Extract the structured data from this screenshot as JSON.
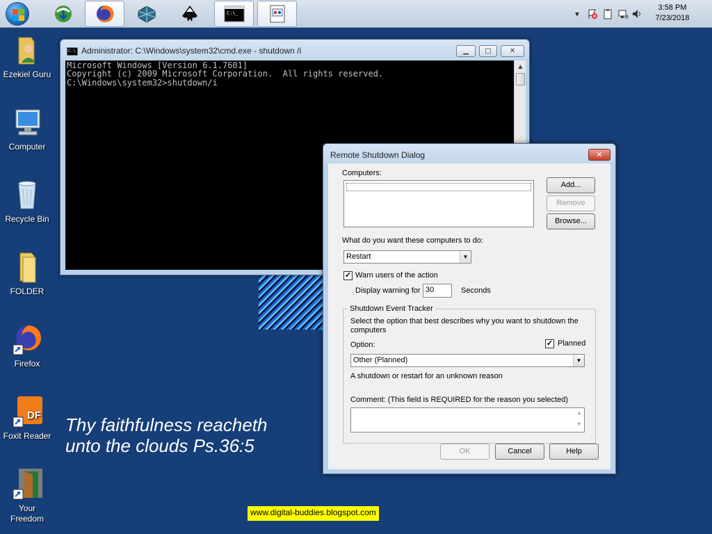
{
  "taskbar": {
    "start_label": "Start",
    "pinned": [
      {
        "name": "internet-download-manager"
      },
      {
        "name": "firefox"
      },
      {
        "name": "sketchup"
      },
      {
        "name": "inkscape"
      },
      {
        "name": "command-prompt"
      },
      {
        "name": "remote-shutdown"
      }
    ],
    "clock": {
      "time": "3:58 PM",
      "date": "7/23/2018"
    }
  },
  "desktop": {
    "icons": [
      {
        "label": "Ezekiel Guru",
        "icon": "user-folder-icon"
      },
      {
        "label": "Computer",
        "icon": "computer-icon"
      },
      {
        "label": "Recycle Bin",
        "icon": "recycle-bin-icon"
      },
      {
        "label": "FOLDER",
        "icon": "folder-icon"
      },
      {
        "label": "Firefox",
        "icon": "firefox-icon"
      },
      {
        "label": "Foxit Reader",
        "icon": "pdf-reader-icon"
      },
      {
        "label": "Your\nFreedom",
        "icon": "door-icon"
      }
    ],
    "verse_line1": "Thy faithfulness reacheth",
    "verse_line2": "unto the clouds Ps.36:5",
    "blog": "www.digital-buddies.blogspot.com"
  },
  "cmd": {
    "title": "Administrator: C:\\Windows\\system32\\cmd.exe - shutdown /i",
    "lines": [
      "Microsoft Windows [Version 6.1.7601]",
      "Copyright (c) 2009 Microsoft Corporation.  All rights reserved.",
      "",
      "C:\\Windows\\system32>shutdown/i"
    ]
  },
  "dialog": {
    "title": "Remote Shutdown Dialog",
    "computers_label": "Computers:",
    "add_button": "Add...",
    "remove_button": "Remove",
    "browse_button": "Browse...",
    "action_label": "What do you want these computers to do:",
    "action_value": "Restart",
    "warn_label": "Warn users of the action",
    "warn_checked": true,
    "display_warning_label": "Display warning for",
    "warning_seconds": "30",
    "seconds_label": "Seconds",
    "tracker": {
      "title": "Shutdown Event Tracker",
      "description": "Select the option that best describes why you want to shutdown the computers",
      "option_label": "Option:",
      "planned_label": "Planned",
      "planned_checked": true,
      "option_value": "Other (Planned)",
      "reason_text": "A shutdown or restart for an unknown reason",
      "comment_label": "Comment: (This field is REQUIRED for the reason you selected)",
      "comment_value": ""
    },
    "ok_button": "OK",
    "cancel_button": "Cancel",
    "help_button": "Help"
  }
}
